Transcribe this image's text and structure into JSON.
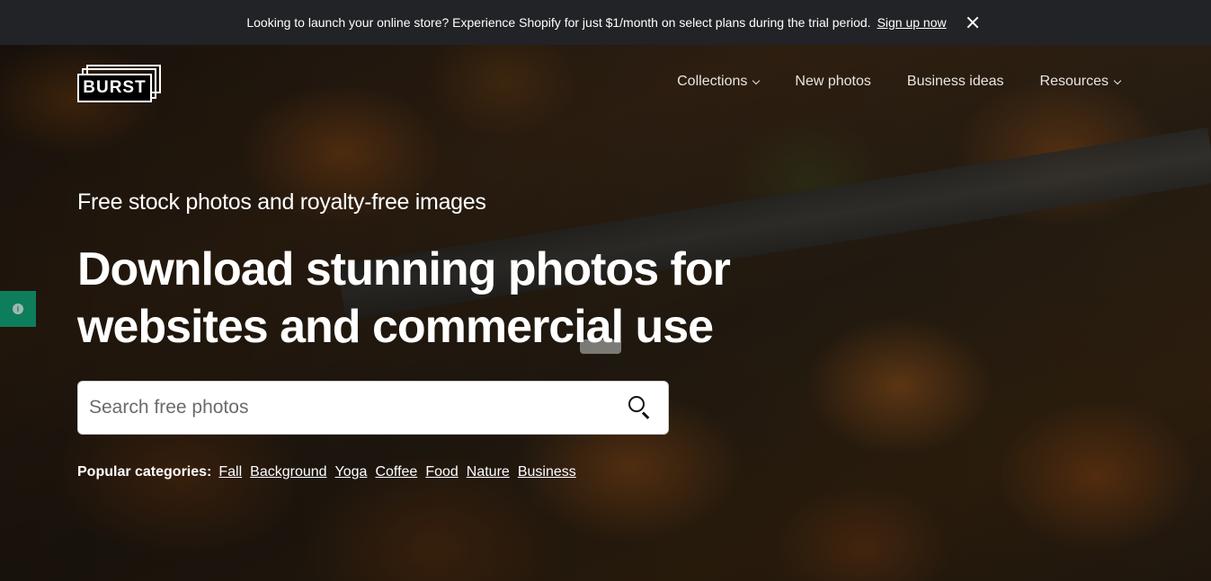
{
  "announcement": {
    "message": "Looking to launch your online store? Experience Shopify for just $1/month on select plans during the trial period.",
    "link": "Sign up now"
  },
  "logo": {
    "text": "BURST"
  },
  "nav": {
    "items": [
      {
        "label": "Collections",
        "has_dropdown": true
      },
      {
        "label": "New photos",
        "has_dropdown": false
      },
      {
        "label": "Business ideas",
        "has_dropdown": false
      },
      {
        "label": "Resources",
        "has_dropdown": true
      }
    ]
  },
  "hero": {
    "subtitle": "Free stock photos and royalty-free images",
    "headline_line1": "Download stunning photos for",
    "headline_line2": "websites and commercial use"
  },
  "search": {
    "placeholder": "Search free photos",
    "value": ""
  },
  "popular": {
    "label": "Popular categories:",
    "categories": [
      "Fall",
      "Background",
      "Yoga",
      "Coffee",
      "Food",
      "Nature",
      "Business"
    ]
  },
  "feedback": {
    "icon": "info-icon",
    "glyph": "i"
  },
  "colors": {
    "announcement_bg": "#212326",
    "feedback_tab": "#0e7d5c"
  }
}
